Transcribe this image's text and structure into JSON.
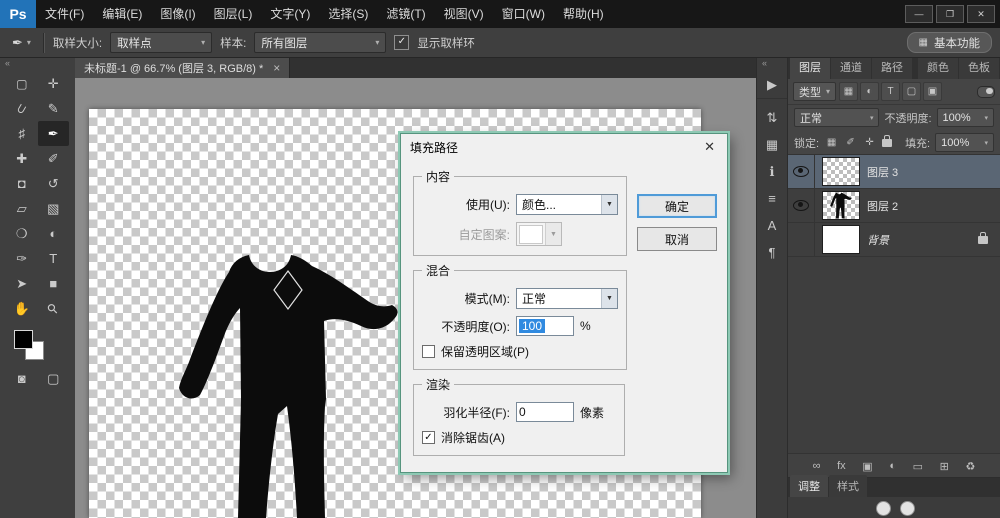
{
  "window": {
    "logo": "Ps",
    "minimize": "—",
    "maximize": "❐",
    "close": "✕"
  },
  "menubar": {
    "items": [
      "文件(F)",
      "编辑(E)",
      "图像(I)",
      "图层(L)",
      "文字(Y)",
      "选择(S)",
      "滤镜(T)",
      "视图(V)",
      "窗口(W)",
      "帮助(H)"
    ]
  },
  "options_bar": {
    "tool_icon": "✒",
    "sample_size_label": "取样大小:",
    "sample_size_value": "取样点",
    "sample_label": "样本:",
    "sample_value": "所有图层",
    "show_ring_checked": "✓",
    "show_ring_label": "显示取样环",
    "workspace_icon": "▦",
    "workspace_label": "基本功能"
  },
  "toolbar": {
    "collapse_icon": "«",
    "tools": [
      {
        "name": "marquee",
        "glyph": "▢"
      },
      {
        "name": "move",
        "glyph": "✛"
      },
      {
        "name": "lasso",
        "glyph": "⊂"
      },
      {
        "name": "quick-select",
        "glyph": "✎"
      },
      {
        "name": "crop",
        "glyph": "♯"
      },
      {
        "name": "eyedropper",
        "glyph": "✒",
        "active": true
      },
      {
        "name": "healing-brush",
        "glyph": "✚"
      },
      {
        "name": "brush",
        "glyph": "✐"
      },
      {
        "name": "clone-stamp",
        "glyph": "◘"
      },
      {
        "name": "history-brush",
        "glyph": "↺"
      },
      {
        "name": "eraser",
        "glyph": "▱"
      },
      {
        "name": "gradient",
        "glyph": "▧"
      },
      {
        "name": "blur",
        "glyph": "❍"
      },
      {
        "name": "dodge",
        "glyph": "◐"
      },
      {
        "name": "pen",
        "glyph": "✑"
      },
      {
        "name": "type",
        "glyph": "T"
      },
      {
        "name": "path-select",
        "glyph": "➤"
      },
      {
        "name": "shape",
        "glyph": "■"
      },
      {
        "name": "hand",
        "glyph": "✋"
      },
      {
        "name": "zoom",
        "glyph": "⚲"
      }
    ],
    "extra_tools": [
      {
        "name": "quick-mask",
        "glyph": "◙"
      },
      {
        "name": "screen-mode",
        "glyph": "▢"
      }
    ]
  },
  "document": {
    "tab_title": "未标题-1 @ 66.7% (图层 3, RGB/8) *",
    "tab_close": "×"
  },
  "dock_strip": {
    "collapse_icon": "«",
    "icons": [
      {
        "name": "expand-dock",
        "glyph": "▶"
      },
      {
        "name": "navigator",
        "glyph": "⇅"
      },
      {
        "name": "swatches",
        "glyph": "▦"
      },
      {
        "name": "info",
        "glyph": "ℹ"
      },
      {
        "name": "actions",
        "glyph": "≡"
      },
      {
        "name": "character-panel",
        "glyph": "A"
      },
      {
        "name": "paragraph-panel",
        "glyph": "¶"
      }
    ]
  },
  "dialog": {
    "title": "填充路径",
    "close": "✕",
    "content_group": "内容",
    "use_label": "使用(U):",
    "use_value": "颜色...",
    "custom_pattern_label": "自定图案:",
    "ok_label": "确定",
    "cancel_label": "取消",
    "blend_group": "混合",
    "mode_label": "模式(M):",
    "mode_value": "正常",
    "opacity_label": "不透明度(O):",
    "opacity_value": "100",
    "opacity_unit": "%",
    "preserve_label": "保留透明区域(P)",
    "render_group": "渲染",
    "feather_label": "羽化半径(F):",
    "feather_value": "0",
    "feather_unit": "像素",
    "antialias_checked": "✓",
    "antialias_label": "消除锯齿(A)"
  },
  "layers_panel": {
    "tabs": [
      {
        "label": "图层",
        "key": "layers",
        "active": true
      },
      {
        "label": "通道",
        "key": "channels"
      },
      {
        "label": "路径",
        "key": "paths"
      }
    ],
    "side_tabs": [
      {
        "label": "颜色",
        "key": "color"
      },
      {
        "label": "色板",
        "key": "swatches"
      }
    ],
    "filter": {
      "kind_label": "类型",
      "chevron": "▾",
      "icons": [
        {
          "name": "filter-pixel",
          "glyph": "▦"
        },
        {
          "name": "filter-adjustment",
          "glyph": "◐"
        },
        {
          "name": "filter-type",
          "glyph": "T"
        },
        {
          "name": "filter-shape",
          "glyph": "▢"
        },
        {
          "name": "filter-smart-object",
          "glyph": "▣"
        }
      ]
    },
    "blend_mode": "正常",
    "opacity_label": "不透明度:",
    "opacity_value": "100%",
    "lock_label": "锁定:",
    "lock_icons": [
      {
        "name": "lock-transparency",
        "glyph": "▦"
      },
      {
        "name": "lock-pixels",
        "glyph": "✐"
      },
      {
        "name": "lock-position",
        "glyph": "✛"
      }
    ],
    "fill_label": "填充:",
    "fill_value": "100%",
    "layers": [
      {
        "name": "图层 3",
        "thumb": "transparent",
        "selected": true,
        "visible": true
      },
      {
        "name": "图层 2",
        "thumb": "body",
        "selected": false,
        "visible": true
      },
      {
        "name": "背景",
        "thumb": "white",
        "selected": false,
        "visible": false,
        "locked": true,
        "italic": true
      }
    ],
    "footer_icons": [
      {
        "name": "link-layers",
        "glyph": "∞"
      },
      {
        "name": "layer-effects",
        "glyph": "fx"
      },
      {
        "name": "layer-mask",
        "glyph": "▣"
      },
      {
        "name": "adjustment-layer",
        "glyph": "◐"
      },
      {
        "name": "layer-group",
        "glyph": "▭"
      },
      {
        "name": "new-layer",
        "glyph": "⊞"
      },
      {
        "name": "delete-layer",
        "glyph": "♻"
      }
    ]
  },
  "adjust_panel": {
    "tabs": [
      {
        "label": "调整",
        "key": "adjustments",
        "active": true
      },
      {
        "label": "样式",
        "key": "styles"
      }
    ],
    "icons": [
      {
        "name": "adjustment-icon-1"
      },
      {
        "name": "adjustment-icon-2"
      }
    ]
  }
}
